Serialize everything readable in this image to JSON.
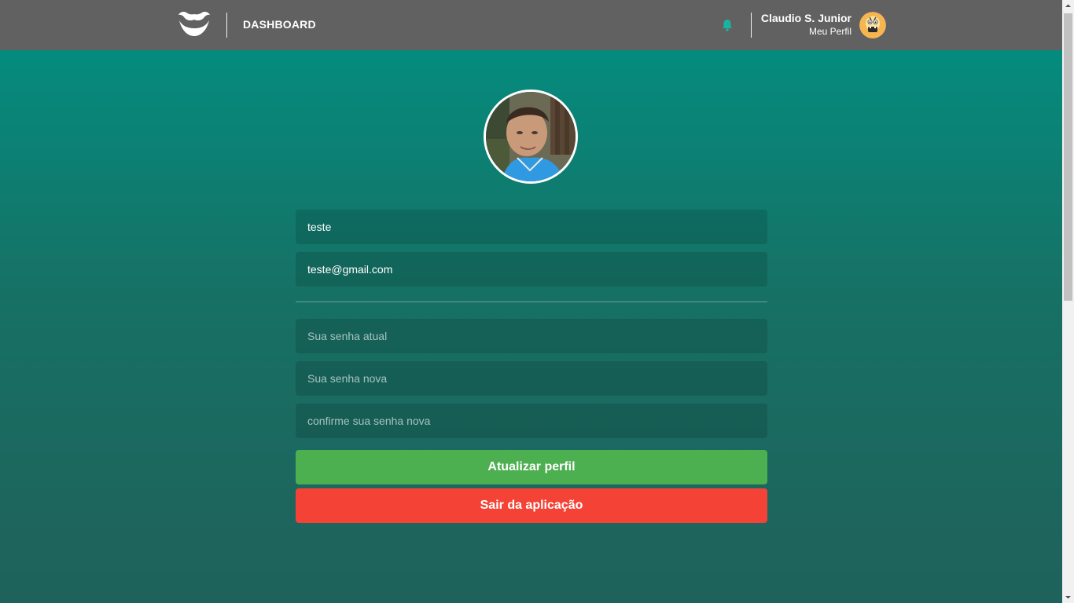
{
  "header": {
    "logo_icon": "mustache-logo-icon",
    "nav_label": "DASHBOARD",
    "notification_icon": "bell-icon",
    "notification_color": "#1bb3a0",
    "user_name": "Claudio S. Junior",
    "profile_link": "Meu Perfil",
    "avatar_icon": "cartoon-avatar-icon"
  },
  "profile": {
    "avatar_icon": "user-photo",
    "name_value": "teste",
    "email_value": "teste@gmail.com",
    "current_password_placeholder": "Sua senha atual",
    "new_password_placeholder": "Sua senha nova",
    "confirm_password_placeholder": "confirme sua senha nova",
    "update_button_label": "Atualizar perfil",
    "logout_button_label": "Sair da aplicação"
  },
  "colors": {
    "header_bg": "#616161",
    "bg_top": "#019183",
    "bg_bottom": "#1f615b",
    "update_button": "#4caf50",
    "logout_button": "#f44336"
  }
}
